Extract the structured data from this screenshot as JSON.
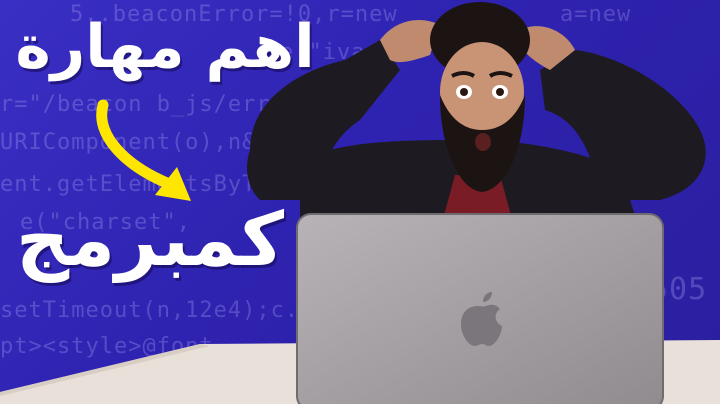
{
  "headline": {
    "line1": "اهم مهارة",
    "line2": "كمبرمج"
  },
  "background_code": [
    "5..beaconError=!0,r=new",
    "e(\"ivar ns",
    "r=\"/beacon b_js/error",
    "URIComponent(o),n&&",
    "ent.getElementsByTag",
    "e(\"charset\",",
    "setTimeout(n,12e4);c.onerror",
    "pt><style>@font",
    "a=new",
    "505"
  ],
  "icons": {
    "arrow": "curved-arrow-icon",
    "logo": "apple-logo-icon"
  },
  "colors": {
    "background": "#2e22b0",
    "arrow": "#ffe600",
    "text": "#ffffff",
    "laptop": "#a6a3a5",
    "shirt": "#1d1a22"
  }
}
